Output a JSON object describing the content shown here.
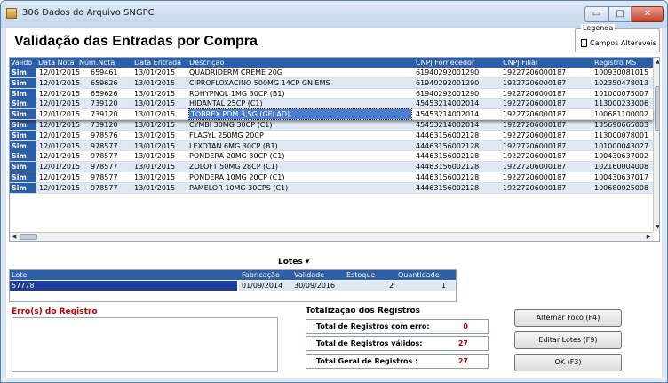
{
  "window": {
    "title": "306 Dados do Arquivo SNGPC",
    "min_label": "▭",
    "max_label": "□",
    "close_label": "✕"
  },
  "heading": "Validação das Entradas por Compra",
  "legend": {
    "title": "Legenda",
    "label": "Campos Alteráveis",
    "swatch_color": "#ffffe1"
  },
  "grid": {
    "columns": [
      "Válido",
      "Data Nota",
      "Núm.Nota",
      "Data Entrada",
      "Descrição",
      "CNPJ Fornecedor",
      "CNPJ Filial",
      "Registro MS"
    ],
    "rows": [
      {
        "valid": "Sim",
        "data_nota": "12/01/2015",
        "num": "659461",
        "data_entrada": "13/01/2015",
        "desc": "QUADRIDERM CREME 20G",
        "cnpj_forn": "61940292001290",
        "cnpj_filial": "19227206000187",
        "registro": "100930081015"
      },
      {
        "valid": "Sim",
        "data_nota": "12/01/2015",
        "num": "659626",
        "data_entrada": "13/01/2015",
        "desc": "CIPROFLOXACINO 500MG 14CP GN EMS",
        "cnpj_forn": "61940292001290",
        "cnpj_filial": "19227206000187",
        "registro": "102350478013"
      },
      {
        "valid": "Sim",
        "data_nota": "12/01/2015",
        "num": "659626",
        "data_entrada": "13/01/2015",
        "desc": "ROHYPNOL 1MG 30CP (B1)",
        "cnpj_forn": "61940292001290",
        "cnpj_filial": "19227206000187",
        "registro": "101000075007"
      },
      {
        "valid": "Sim",
        "data_nota": "12/01/2015",
        "num": "739120",
        "data_entrada": "13/01/2015",
        "desc": "HIDANTAL 25CP (C1)",
        "cnpj_forn": "45453214002014",
        "cnpj_filial": "19227206000187",
        "registro": "113000233006"
      },
      {
        "valid": "Sim",
        "data_nota": "12/01/2015",
        "num": "739120",
        "data_entrada": "13/01/2015",
        "desc": "TOBREX POM 3,5G (GELAD)",
        "cnpj_forn": "45453214002014",
        "cnpj_filial": "19227206000187",
        "registro": "100681100002"
      },
      {
        "valid": "Sim",
        "data_nota": "12/01/2015",
        "num": "739120",
        "data_entrada": "13/01/2015",
        "desc": "CYMBI 30MG 30CP (C1)",
        "cnpj_forn": "45453214002014",
        "cnpj_filial": "19227206000187",
        "registro": "135690665003"
      },
      {
        "valid": "Sim",
        "data_nota": "12/01/2015",
        "num": "978576",
        "data_entrada": "13/01/2015",
        "desc": "FLAGYL 250MG 20CP",
        "cnpj_forn": "44463156002128",
        "cnpj_filial": "19227206000187",
        "registro": "113000078001"
      },
      {
        "valid": "Sim",
        "data_nota": "12/01/2015",
        "num": "978577",
        "data_entrada": "13/01/2015",
        "desc": "LEXOTAN 6MG 30CP (B1)",
        "cnpj_forn": "44463156002128",
        "cnpj_filial": "19227206000187",
        "registro": "101000043027"
      },
      {
        "valid": "Sim",
        "data_nota": "12/01/2015",
        "num": "978577",
        "data_entrada": "13/01/2015",
        "desc": "PONDERA 20MG 30CP (C1)",
        "cnpj_forn": "44463156002128",
        "cnpj_filial": "19227206000187",
        "registro": "100430637002"
      },
      {
        "valid": "Sim",
        "data_nota": "12/01/2015",
        "num": "978577",
        "data_entrada": "13/01/2015",
        "desc": "ZOLOFT 50MG 28CP (C1)",
        "cnpj_forn": "44463156002128",
        "cnpj_filial": "19227206000187",
        "registro": "102160004008"
      },
      {
        "valid": "Sim",
        "data_nota": "12/01/2015",
        "num": "978577",
        "data_entrada": "13/01/2015",
        "desc": "PONDERA 10MG 20CP (C1)",
        "cnpj_forn": "44463156002128",
        "cnpj_filial": "19227206000187",
        "registro": "100430637017"
      },
      {
        "valid": "Sim",
        "data_nota": "12/01/2015",
        "num": "978577",
        "data_entrada": "13/01/2015",
        "desc": "PAMELOR 10MG 30CPS (C1)",
        "cnpj_forn": "44463156002128",
        "cnpj_filial": "19227206000187",
        "registro": "100680025008"
      }
    ],
    "selected_index": 4
  },
  "lotes": {
    "toggle_label": "Lotes ▾",
    "columns": [
      "Lote",
      "Fabricação",
      "Validade",
      "Estoque",
      "Quantidade"
    ],
    "row": {
      "lote": "57778",
      "fabricacao": "01/09/2014",
      "validade": "30/09/2016",
      "estoque": "2",
      "quantidade": "1"
    }
  },
  "errors": {
    "label": "Erro(s) do Registro"
  },
  "totals": {
    "title": "Totalização dos Registros",
    "com_erro_label": "Total de Registros com erro:",
    "com_erro_value": "0",
    "validos_label": "Total de Registros válidos:",
    "validos_value": "27",
    "geral_label": "Total Geral de Registros :",
    "geral_value": "27"
  },
  "buttons": {
    "alternar_foco": "Alternar Foco (F4)",
    "editar_lotes": "Editar Lotes (F9)",
    "ok": "OK (F3)"
  }
}
